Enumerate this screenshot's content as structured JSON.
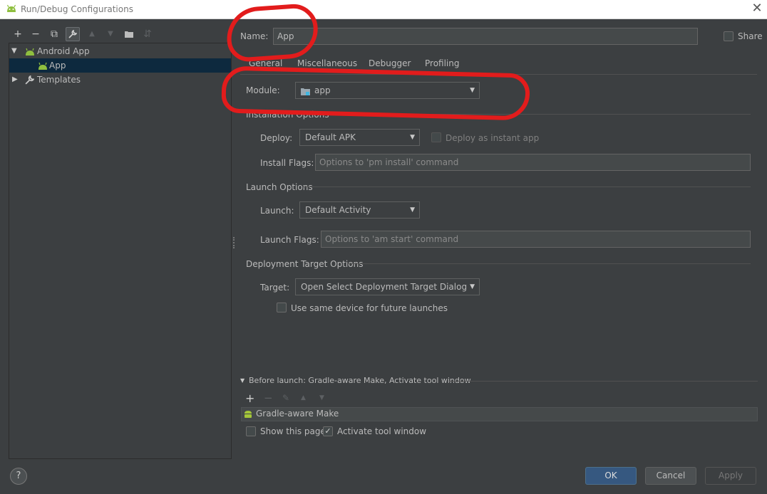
{
  "window": {
    "title": "Run/Debug Configurations",
    "close_glyph": "✕"
  },
  "toolbar": {
    "add": "+",
    "remove": "−",
    "copy": "⧉",
    "edit_templates": "🔧",
    "move_up": "▲",
    "move_down": "▼",
    "new_folder": "▣",
    "sort": "⇵"
  },
  "tree": {
    "items": [
      {
        "label": "Android App",
        "expanded": true,
        "icon": "android-icon"
      },
      {
        "label": "App",
        "selected": true,
        "icon": "android-icon"
      },
      {
        "label": "Templates",
        "expanded": false,
        "icon": "wrench-icon"
      }
    ]
  },
  "form": {
    "name_label": "Name:",
    "name_value": "App",
    "share_label": "Share",
    "tabs": [
      "General",
      "Miscellaneous",
      "Debugger",
      "Profiling"
    ],
    "module_label": "Module:",
    "module_value": "app",
    "installation_options": "Installation Options",
    "deploy_label": "Deploy:",
    "deploy_value": "Default APK",
    "deploy_instant_label": "Deploy as instant app",
    "install_flags_label": "Install Flags:",
    "install_flags_placeholder": "Options to 'pm install' command",
    "launch_options": "Launch Options",
    "launch_label": "Launch:",
    "launch_value": "Default Activity",
    "launch_flags_label": "Launch Flags:",
    "launch_flags_placeholder": "Options to 'am start' command",
    "deployment_target_options": "Deployment Target Options",
    "target_label": "Target:",
    "target_value": "Open Select Deployment Target Dialog",
    "same_device_label": "Use same device for future launches"
  },
  "before_launch": {
    "title": "Before launch: Gradle-aware Make, Activate tool window",
    "task": "Gradle-aware Make",
    "show_page_label": "Show this page",
    "show_page_checked": false,
    "activate_tool_label": "Activate tool window",
    "activate_tool_checked": true
  },
  "buttons": {
    "ok": "OK",
    "cancel": "Cancel",
    "apply": "Apply",
    "help": "?"
  },
  "colors": {
    "annotation": "#e21c1c",
    "accent": "#365880",
    "selection": "#0d293e",
    "android": "#a4c639"
  }
}
